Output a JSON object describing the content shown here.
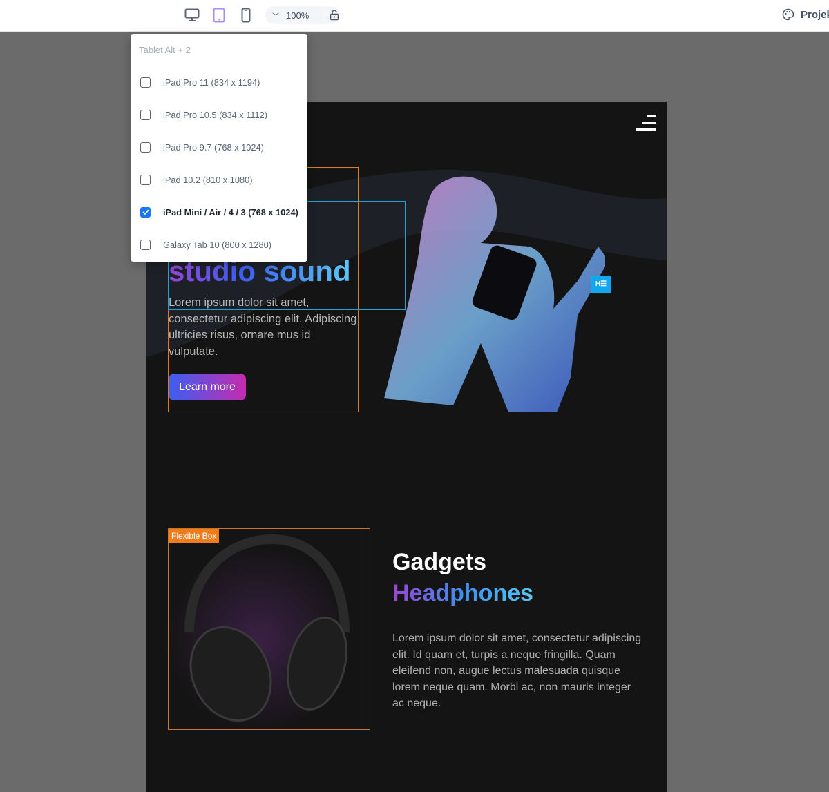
{
  "toolbar": {
    "devices": [
      {
        "name": "desktop",
        "active": false
      },
      {
        "name": "tablet",
        "active": true
      },
      {
        "name": "mobile",
        "active": false
      }
    ],
    "zoom": "100%",
    "theme_label": "Projek",
    "accent": "#a78bfa"
  },
  "dropdown": {
    "title": "Tablet Alt + 2",
    "items": [
      {
        "label": "iPad Pro 11 (834 x 1194)",
        "checked": false
      },
      {
        "label": "iPad Pro 10.5 (834 x 1112)",
        "checked": false
      },
      {
        "label": "iPad Pro 9.7 (768 x 1024)",
        "checked": false
      },
      {
        "label": "iPad 10.2 (810 x 1080)",
        "checked": false
      },
      {
        "label": "iPad Mini / Air / 4 / 3 (768 x 1024)",
        "checked": true
      },
      {
        "label": "Galaxy Tab 10 (800 x 1280)",
        "checked": false
      }
    ],
    "check_color": "#1877f2"
  },
  "hero": {
    "heading_gradient": "studio sound",
    "text": "Lorem ipsum dolor sit amet, consectetur adipiscing elit. Adipiscing ultricies risus, ornare mus id vulputate.",
    "button": "Learn more",
    "widget_badge": "H☰"
  },
  "gadgets": {
    "badge": "Flexible Box",
    "title1": "Gadgets",
    "title2": "Headphones",
    "text": "Lorem ipsum dolor sit amet, consectetur adipiscing elit. Id quam et, turpis a neque fringilla. Quam eleifend non, augue lectus malesuada quisque lorem neque quam. Morbi ac, non mauris integer ac neque."
  }
}
